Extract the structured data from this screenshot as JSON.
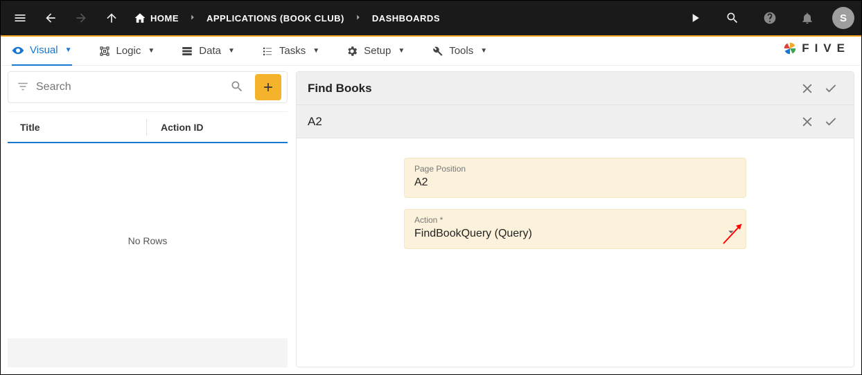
{
  "topbar": {
    "breadcrumbs": {
      "home": "HOME",
      "app": "APPLICATIONS (BOOK CLUB)",
      "dash": "DASHBOARDS"
    },
    "avatar_letter": "S"
  },
  "tabs": {
    "visual": "Visual",
    "logic": "Logic",
    "data": "Data",
    "tasks": "Tasks",
    "setup": "Setup",
    "tools": "Tools"
  },
  "logo_text": "FIVE",
  "search": {
    "placeholder": "Search"
  },
  "table": {
    "col_title": "Title",
    "col_action": "Action ID",
    "empty": "No Rows"
  },
  "right": {
    "header1": "Find Books",
    "header2": "A2",
    "fields": {
      "page_position": {
        "label": "Page Position",
        "value": "A2"
      },
      "action": {
        "label": "Action *",
        "value": "FindBookQuery (Query)"
      }
    }
  }
}
